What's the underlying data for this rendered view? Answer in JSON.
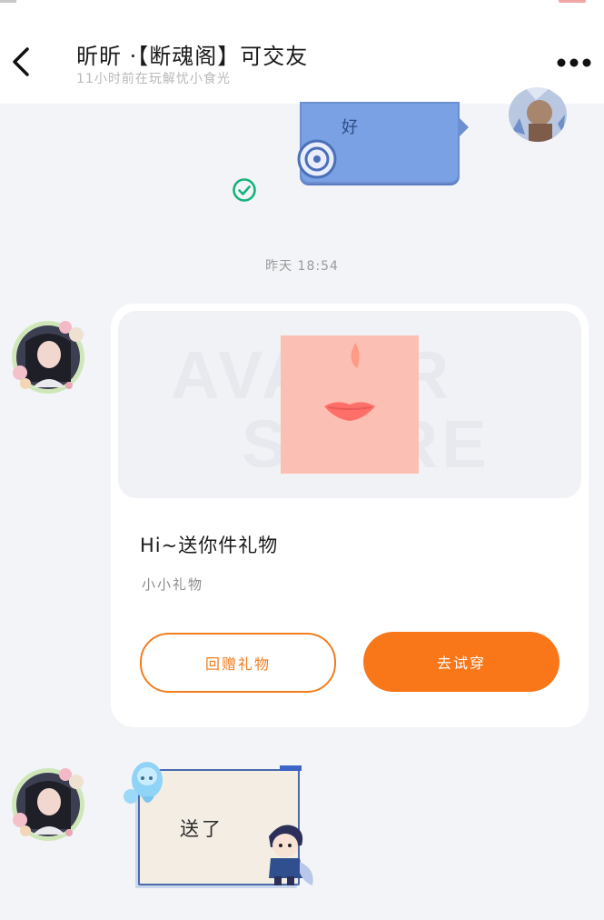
{
  "header": {
    "title": "昕昕 ·【断魂阁】可交友",
    "subtitle": "11小时前在玩解忧小食光"
  },
  "messages": {
    "sent_text": "好",
    "timestamp": "昨天 18:54",
    "gift": {
      "watermark_line1": "AVATAR",
      "watermark_line2": "STORE",
      "title": "Hi~送你件礼物",
      "subtitle": "小小礼物",
      "return_label": "回赠礼物",
      "tryon_label": "去试穿"
    },
    "recv_text": "送了"
  },
  "colors": {
    "accent": "#f97619",
    "sent_bubble": "#7aa1e3",
    "read_check": "#16b27a",
    "background": "#f3f4f8"
  },
  "icons": [
    "back-arrow-icon",
    "more-dots-icon",
    "read-check-icon"
  ]
}
